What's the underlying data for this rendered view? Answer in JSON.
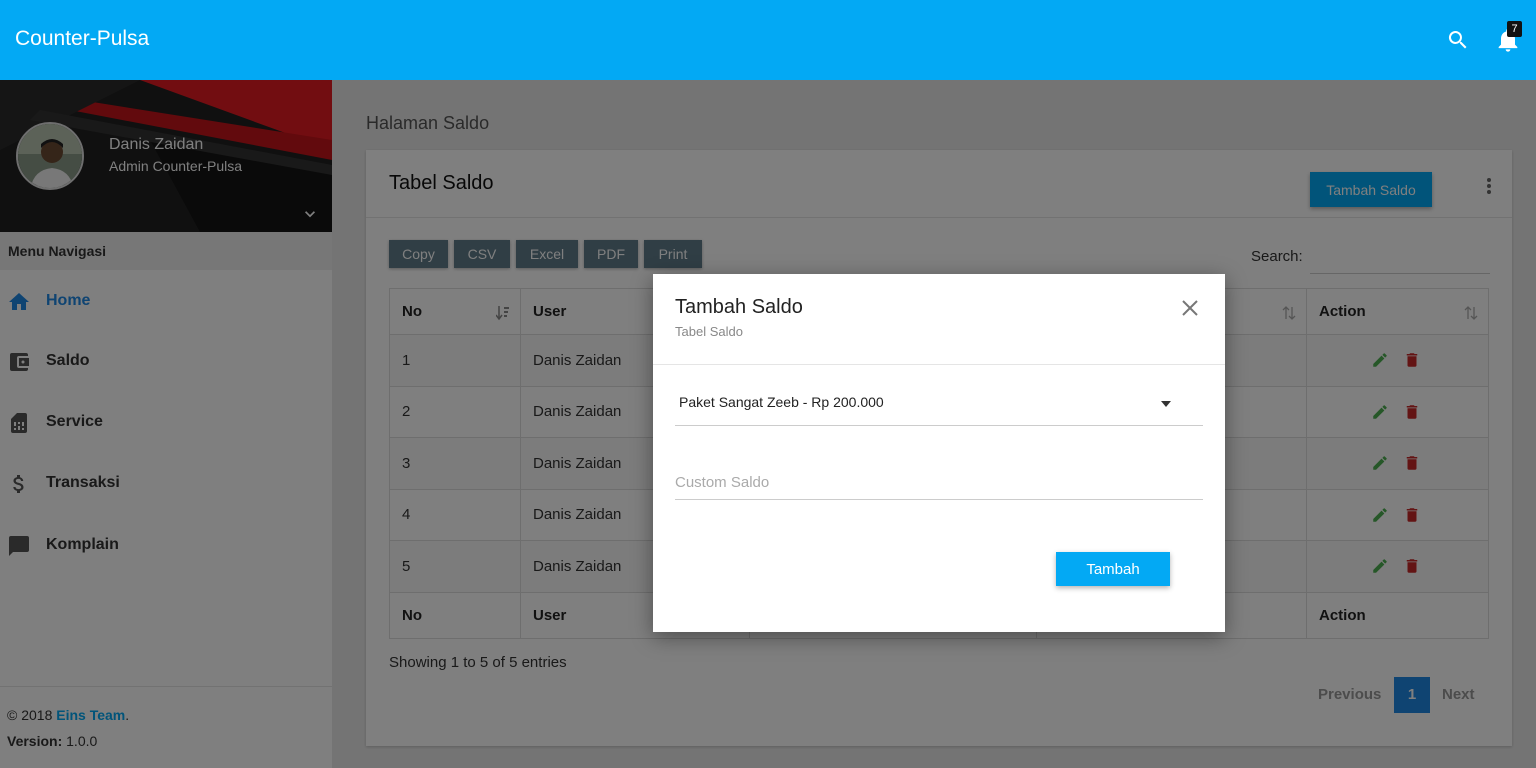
{
  "app": {
    "title": "Counter-Pulsa",
    "notification_count": "7"
  },
  "user": {
    "name": "Danis Zaidan",
    "role": "Admin Counter-Pulsa"
  },
  "sidebar": {
    "menu_header": "Menu Navigasi",
    "items": [
      {
        "label": "Home",
        "icon": "home-icon",
        "active": true
      },
      {
        "label": "Saldo",
        "icon": "wallet-icon"
      },
      {
        "label": "Service",
        "icon": "sim-card-icon"
      },
      {
        "label": "Transaksi",
        "icon": "dollar-icon"
      },
      {
        "label": "Komplain",
        "icon": "chat-icon"
      }
    ],
    "footer": {
      "copyright": "© 2018",
      "team": "Eins Team",
      "dot": ".",
      "version_label": "Version:",
      "version": "1.0.0"
    }
  },
  "page": {
    "heading": "Halaman Saldo",
    "card_title": "Tabel Saldo",
    "add_button": "Tambah Saldo",
    "export_buttons": [
      "Copy",
      "CSV",
      "Excel",
      "PDF",
      "Print"
    ],
    "search_label": "Search:",
    "table": {
      "columns": [
        "No",
        "User",
        "",
        "",
        "Action"
      ],
      "rows": [
        {
          "no": "1",
          "user": "Danis Zaidan"
        },
        {
          "no": "2",
          "user": "Danis Zaidan"
        },
        {
          "no": "3",
          "user": "Danis Zaidan"
        },
        {
          "no": "4",
          "user": "Danis Zaidan"
        },
        {
          "no": "5",
          "user": "Danis Zaidan"
        }
      ]
    },
    "info": "Showing 1 to 5 of 5 entries",
    "pagination": {
      "prev": "Previous",
      "current": "1",
      "next": "Next"
    }
  },
  "modal": {
    "title": "Tambah Saldo",
    "subtitle": "Tabel Saldo",
    "select_value": "Paket Sangat Zeeb - Rp 200.000",
    "custom_placeholder": "Custom Saldo",
    "submit": "Tambah"
  },
  "colors": {
    "primary": "#03a9f4",
    "active_nav": "#1e88e5",
    "edit": "#4caf50",
    "delete": "#c62828",
    "export_button": "#607d8b"
  }
}
